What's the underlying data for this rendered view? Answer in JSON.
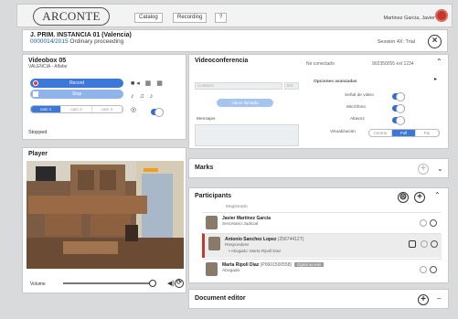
{
  "header": {
    "logo": "ARCONTE",
    "catalog": "Catalog",
    "recording": "Recording",
    "help": "?",
    "user": "Martinez Garcia, Javier"
  },
  "case": {
    "title": "J. PRIM. INSTANCIA 01 (Valencia)",
    "number": "0000014/2015",
    "proceeding": "Ordinary proceeding",
    "session": "Session 4X: Trial"
  },
  "videobox": {
    "title": "Videobox 05",
    "subtitle": "VALENCIA - Alfafar",
    "record_label": "Record",
    "stop_label": "Stop",
    "cams": [
      "cam 1",
      "cam 2",
      "cam 3"
    ],
    "status": "Stopped"
  },
  "player": {
    "title": "Player",
    "volume_label": "Volume",
    "volume_level": 0.85
  },
  "videoconf": {
    "title": "Videoconferencia",
    "status": "No conectado",
    "phone": "902350055 ext 1234",
    "contact_placeholder": "Contacto",
    "ext_placeholder": "Ext",
    "call_label": "Hacer llamada",
    "messages_label": "Mensajes",
    "advanced_label": "Opciones avanzadas",
    "video_signal": "Señal de video",
    "microphone": "Micrófono",
    "speaker": "Altavoz",
    "visualization": "Visualización",
    "vis_options": [
      "Centrar",
      "Full",
      "Pip"
    ]
  },
  "marks": {
    "title": "Marks"
  },
  "participants": {
    "title": "Participants",
    "top_partial": "Magistrado",
    "list": [
      {
        "name": "Javier Martinez Garcia",
        "role": "Secretario Judicial"
      },
      {
        "name": "Antonio Sanchez Lopez",
        "id": "(25674412T)",
        "role": "Respondent",
        "sub": "• Abogado: Marta Ripoll Diaz"
      },
      {
        "name": "Marta Ripoll Diaz",
        "id": "(P0601500558)",
        "badge": "Digital access",
        "role": "Abogado"
      }
    ]
  },
  "doc_editor": {
    "title": "Document editor"
  }
}
